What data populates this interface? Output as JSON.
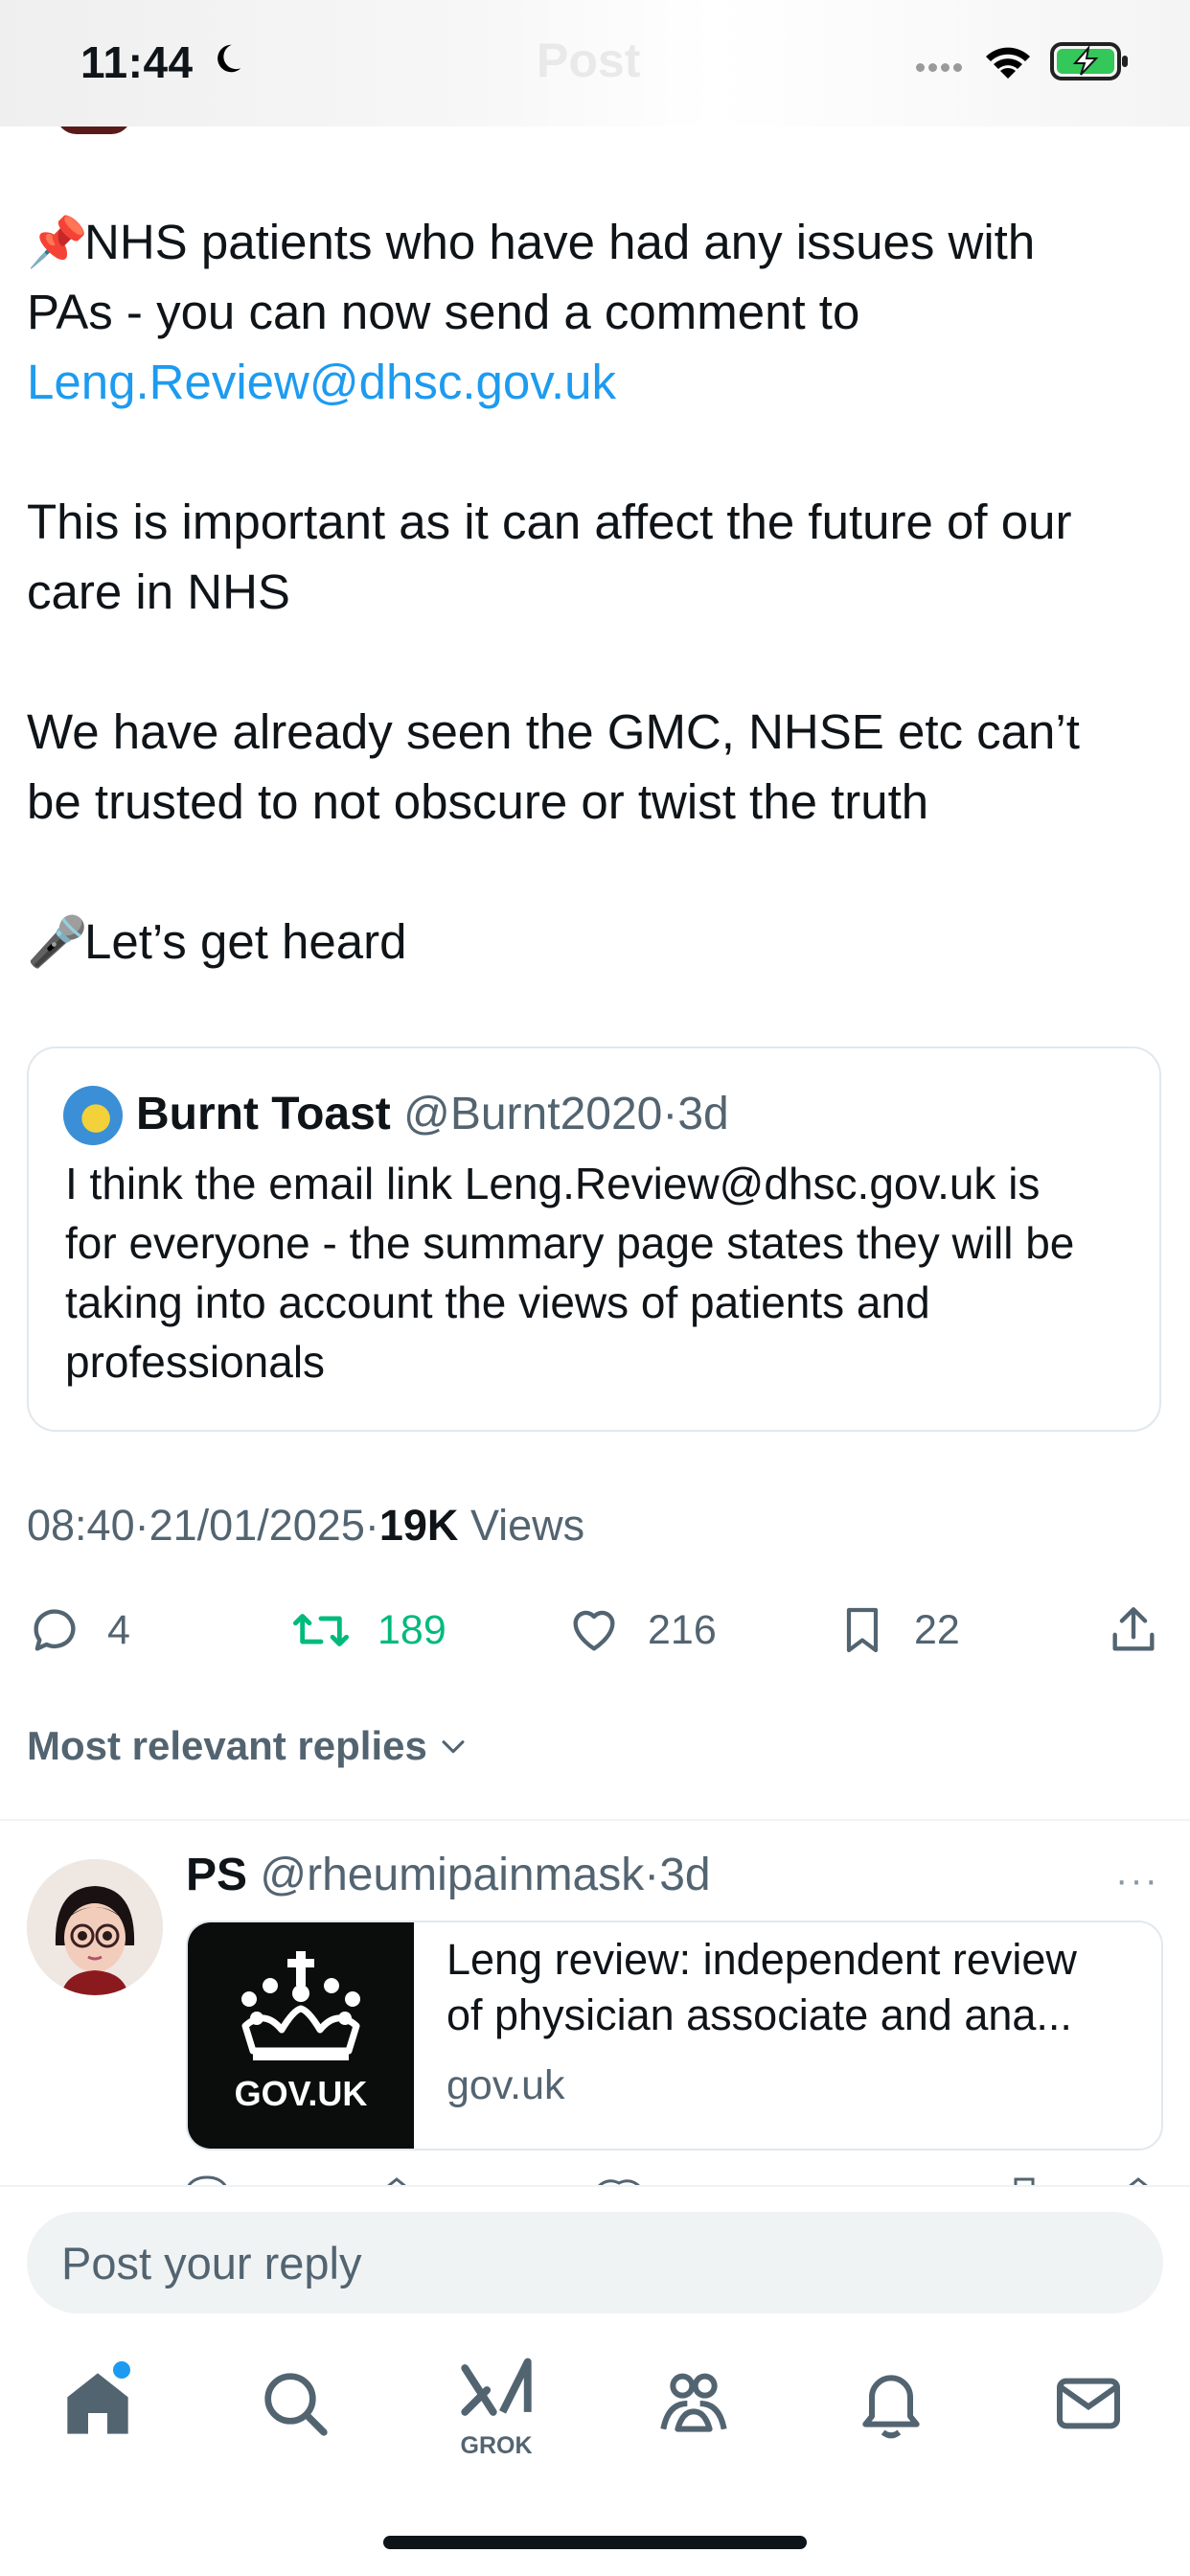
{
  "status_bar": {
    "time": "11:44"
  },
  "header": {
    "title": "Post"
  },
  "tweet": {
    "line1": "NHS patients who have had any issues with",
    "line2": "PAs - you can now send a comment to",
    "email_link": "Leng.Review@dhsc.gov.uk",
    "para2_line1": "This is important as it can affect the future of our",
    "para2_line2": "care in NHS",
    "para3_line1": "We have already seen the GMC, NHSE etc can’t",
    "para3_line2": "be trusted to not obscure or twist the truth",
    "para4": "Let’s get heard",
    "emoji_pin": "📌",
    "emoji_mic": "🎤"
  },
  "quote": {
    "name": "Burnt Toast",
    "handle": "@Burnt2020",
    "dot": "·",
    "time": "3d",
    "line1": "I think the email link Leng.Review@dhsc.gov.uk is",
    "line2": "for everyone - the summary page states they will be",
    "line3": "taking into account the views of patients and",
    "line4": "professionals"
  },
  "meta": {
    "time": "08:40",
    "sep1": "·",
    "date": "21/01/2025",
    "sep2": "·",
    "views_count": "19K",
    "views_label": "Views"
  },
  "actions": {
    "replies": "4",
    "retweets": "189",
    "likes": "216",
    "bookmarks": "22"
  },
  "colors": {
    "accent": "#1d9bf0",
    "retweet": "#00ba7c",
    "muted": "#536471",
    "text": "#0f1419"
  },
  "replies_filter": {
    "label": "Most relevant replies"
  },
  "reply": {
    "name": "PS",
    "handle": "@rheumipainmask",
    "dot": "·",
    "time": "3d",
    "more": "···",
    "card_logo_text": "GOV.UK",
    "card_title_line1": "Leng review: independent review",
    "card_title_line2": "of physician associate and ana...",
    "card_domain": "gov.uk"
  },
  "composer": {
    "placeholder": "Post your reply"
  },
  "nav": {
    "grok_label": "GROK",
    "items": [
      "home-icon",
      "search-icon",
      "grok-icon",
      "communities-icon",
      "notifications-icon",
      "messages-icon"
    ]
  }
}
